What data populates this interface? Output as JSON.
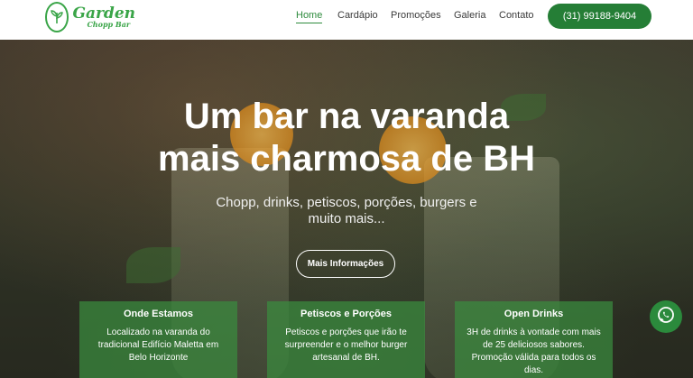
{
  "brand": {
    "logo_title": "Garden",
    "logo_subtitle": "Chopp Bar",
    "accent": "#257e36",
    "icon": "leaf-icon"
  },
  "nav": {
    "items": [
      "Home",
      "Cardápio",
      "Promoções",
      "Galeria",
      "Contato"
    ],
    "active": "Home",
    "phone": "(31) 99188-9404"
  },
  "hero": {
    "title_line1": "Um bar na varanda",
    "title_line2": "mais charmosa de BH",
    "subtitle": "Chopp, drinks, petiscos, porções, burgers e muito mais...",
    "button": "Mais Informações"
  },
  "cards": [
    {
      "title": "Onde Estamos",
      "text": "Localizado na varanda do tradicional Edifício Maletta em Belo Horizonte"
    },
    {
      "title": "Petiscos e Porções",
      "text": "Petiscos e porções que irão te surpreender e o melhor burger artesanal de BH."
    },
    {
      "title": "Open Drinks",
      "text": "3H de drinks à vontade com mais de 25 deliciosos sabores. Promoção válida para todos os dias."
    }
  ],
  "whatsapp": {
    "icon": "whatsapp-icon"
  }
}
